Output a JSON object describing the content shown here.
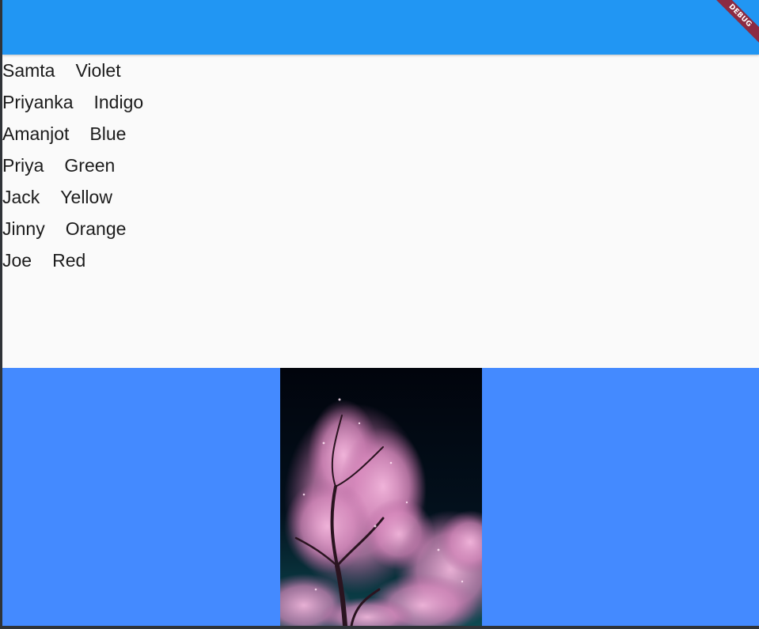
{
  "app_bar": {
    "color": "#2196f3",
    "debug_banner": "DEBUG"
  },
  "people": [
    {
      "name": "Samta",
      "color": "Violet"
    },
    {
      "name": "Priyanka",
      "color": "Indigo"
    },
    {
      "name": "Amanjot",
      "color": "Blue"
    },
    {
      "name": "Priya",
      "color": "Green"
    },
    {
      "name": "Jack",
      "color": "Yellow"
    },
    {
      "name": "Jinny",
      "color": "Orange"
    },
    {
      "name": "Joe",
      "color": "Red"
    }
  ],
  "image_panel": {
    "background": "#448aff",
    "image": "pink-blossom-tree-night-photo"
  }
}
